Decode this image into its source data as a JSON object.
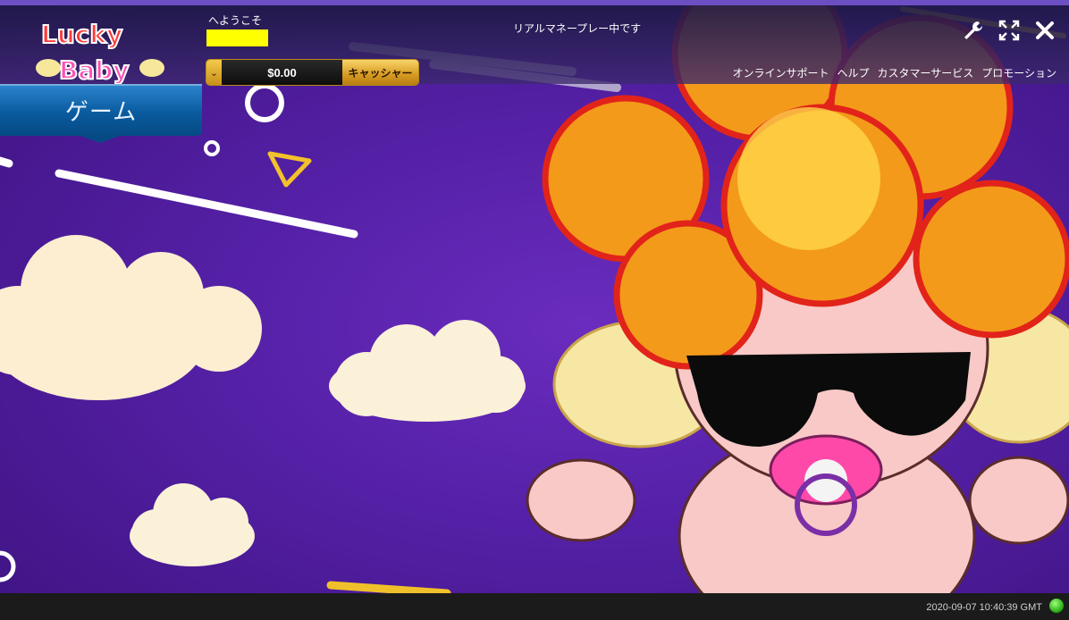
{
  "header": {
    "welcome_text": "へようこそ",
    "mode_text": "リアルマネープレー中です",
    "balance": "$0.00",
    "cashier_label": "キャッシャー",
    "links": [
      "オンラインサポート",
      "ヘルプ",
      "カスタマーサービス",
      "プロモーション"
    ]
  },
  "logo": {
    "line1": "Lucky",
    "line2": "Baby"
  },
  "games_tab": {
    "label": "ゲーム"
  },
  "status": {
    "clock": "2020-09-07 10:40:39 GMT"
  },
  "colors": {
    "accent": "#5420a6",
    "user_box": "#ffff00",
    "cashier": "#d69a22",
    "games_tab": "#0a5b9f"
  },
  "icons": [
    "wrench-icon",
    "fullscreen-icon",
    "close-icon",
    "connection-status-icon"
  ]
}
